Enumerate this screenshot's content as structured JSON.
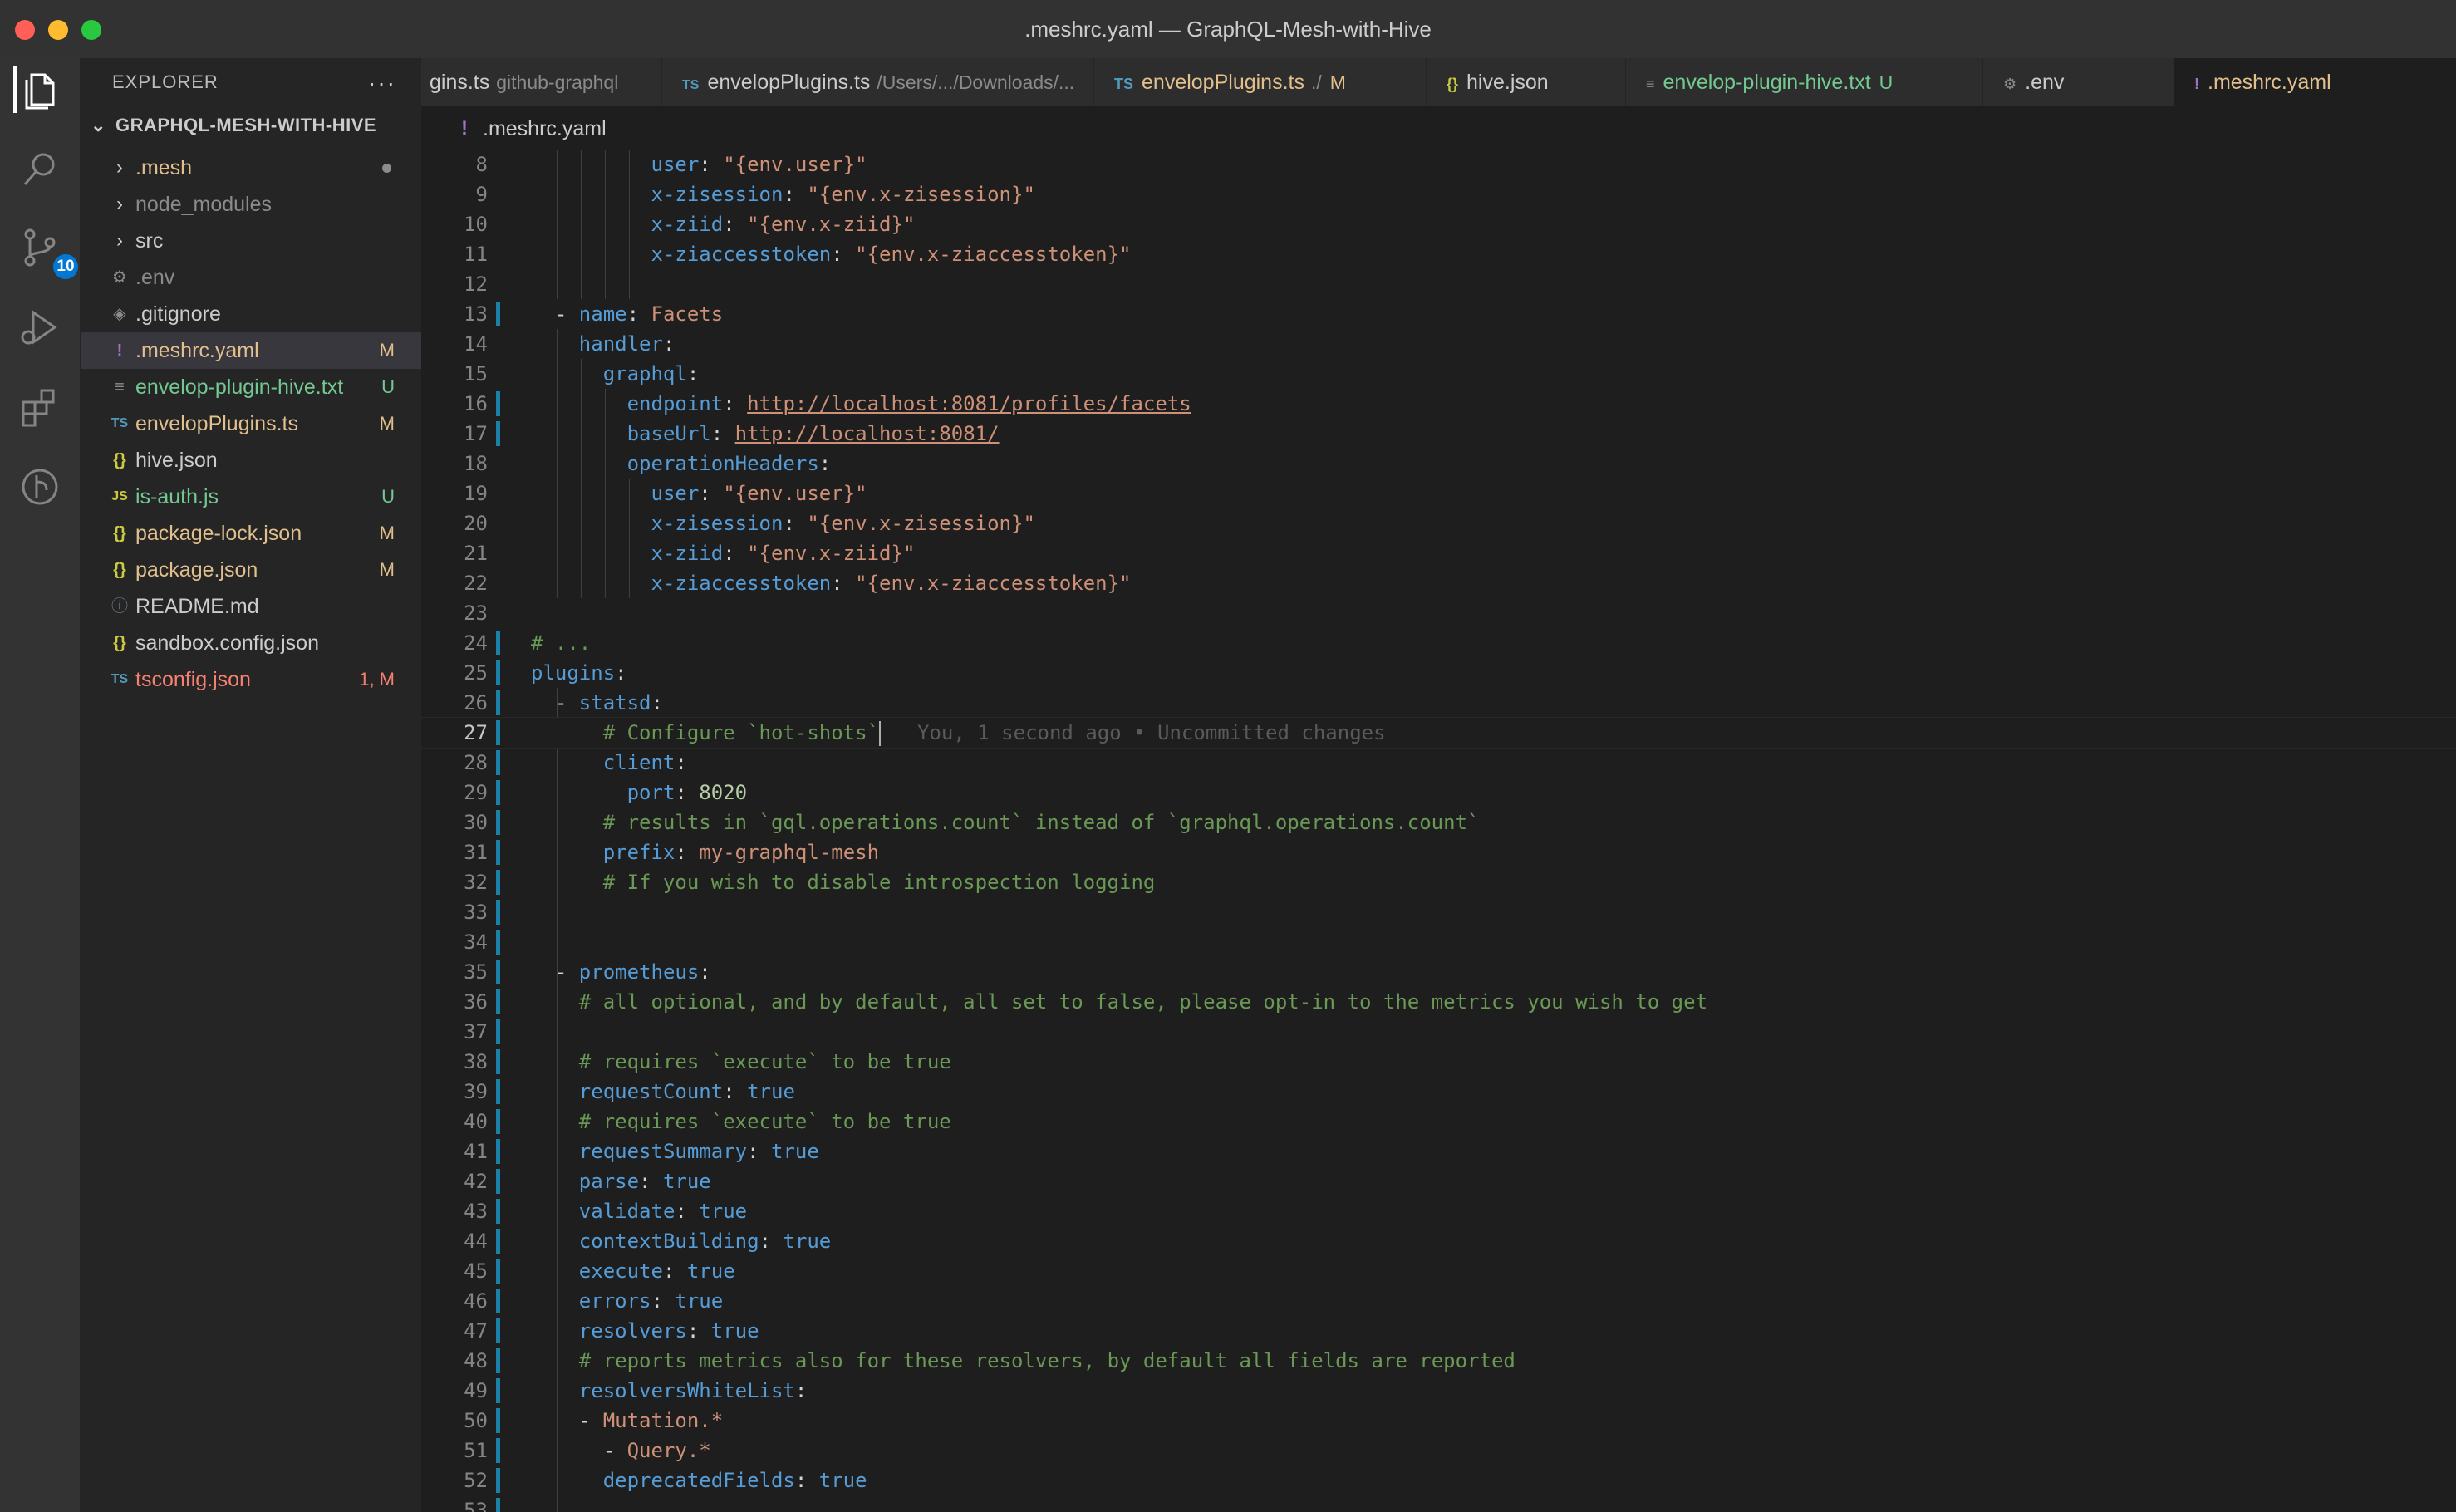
{
  "window": {
    "title": ".meshrc.yaml — GraphQL-Mesh-with-Hive"
  },
  "activity": {
    "scm_badge": "10"
  },
  "sidebar": {
    "header": "EXPLORER",
    "more": "···",
    "project": "GRAPHQL-MESH-WITH-HIVE",
    "items": [
      {
        "name": ".mesh",
        "icon": "›",
        "status": ""
      },
      {
        "name": "node_modules",
        "icon": "›",
        "status": ""
      },
      {
        "name": "src",
        "icon": "›",
        "status": ""
      },
      {
        "name": ".env",
        "icon": "⚙",
        "status": ""
      },
      {
        "name": ".gitignore",
        "icon": "◈",
        "status": ""
      },
      {
        "name": ".meshrc.yaml",
        "icon": "!",
        "status": "M"
      },
      {
        "name": "envelop-plugin-hive.txt",
        "icon": "≡",
        "status": "U"
      },
      {
        "name": "envelopPlugins.ts",
        "icon": "TS",
        "status": "M"
      },
      {
        "name": "hive.json",
        "icon": "{}",
        "status": ""
      },
      {
        "name": "is-auth.js",
        "icon": "JS",
        "status": "U"
      },
      {
        "name": "package-lock.json",
        "icon": "{}",
        "status": "M"
      },
      {
        "name": "package.json",
        "icon": "{}",
        "status": "M"
      },
      {
        "name": "README.md",
        "icon": "ⓘ",
        "status": ""
      },
      {
        "name": "sandbox.config.json",
        "icon": "{}",
        "status": ""
      },
      {
        "name": "tsconfig.json",
        "icon": "TS",
        "status": "1, M"
      }
    ]
  },
  "tabs": [
    {
      "label": "gins.ts",
      "desc": "github-graphql",
      "icon": "",
      "mark": ""
    },
    {
      "label": "envelopPlugins.ts",
      "desc": "/Users/.../Downloads/...",
      "icon": "TS",
      "mark": ""
    },
    {
      "label": "envelopPlugins.ts",
      "desc": "./",
      "icon": "TS",
      "mark": "M"
    },
    {
      "label": "hive.json",
      "desc": "",
      "icon": "{}",
      "mark": ""
    },
    {
      "label": "envelop-plugin-hive.txt",
      "desc": "",
      "icon": "≡",
      "mark": "U"
    },
    {
      "label": ".env",
      "desc": "",
      "icon": "⚙",
      "mark": ""
    },
    {
      "label": ".meshrc.yaml",
      "desc": "",
      "icon": "!",
      "mark": ""
    }
  ],
  "breadcrumb": {
    "icon": "!",
    "file": ".meshrc.yaml"
  },
  "editor": {
    "blame": "You, 1 second ago • Uncommitted changes",
    "lines": [
      {
        "n": "8",
        "parts": [
          [
            "k",
            "user"
          ],
          [
            "p",
            ": "
          ],
          [
            "s",
            "\"{env.user}\""
          ]
        ]
      },
      {
        "n": "9",
        "parts": [
          [
            "k",
            "x-zisession"
          ],
          [
            "p",
            ": "
          ],
          [
            "s",
            "\"{env.x-zisession}\""
          ]
        ]
      },
      {
        "n": "10",
        "parts": [
          [
            "k",
            "x-ziid"
          ],
          [
            "p",
            ": "
          ],
          [
            "s",
            "\"{env.x-ziid}\""
          ]
        ]
      },
      {
        "n": "11",
        "parts": [
          [
            "k",
            "x-ziaccesstoken"
          ],
          [
            "p",
            ": "
          ],
          [
            "s",
            "\"{env.x-ziaccesstoken}\""
          ]
        ]
      },
      {
        "n": "12",
        "parts": []
      },
      {
        "n": "13",
        "parts": [
          [
            "p",
            "- "
          ],
          [
            "k",
            "name"
          ],
          [
            "p",
            ": "
          ],
          [
            "s",
            "Facets"
          ]
        ]
      },
      {
        "n": "14",
        "parts": [
          [
            "k",
            "handler"
          ],
          [
            "p",
            ":"
          ]
        ]
      },
      {
        "n": "15",
        "parts": [
          [
            "k",
            "graphql"
          ],
          [
            "p",
            ":"
          ]
        ]
      },
      {
        "n": "16",
        "parts": [
          [
            "k",
            "endpoint"
          ],
          [
            "p",
            ": "
          ],
          [
            "u",
            "http://localhost:8081/profiles/facets"
          ]
        ]
      },
      {
        "n": "17",
        "parts": [
          [
            "k",
            "baseUrl"
          ],
          [
            "p",
            ": "
          ],
          [
            "u",
            "http://localhost:8081/"
          ]
        ]
      },
      {
        "n": "18",
        "parts": [
          [
            "k",
            "operationHeaders"
          ],
          [
            "p",
            ":"
          ]
        ]
      },
      {
        "n": "19",
        "parts": [
          [
            "k",
            "user"
          ],
          [
            "p",
            ": "
          ],
          [
            "s",
            "\"{env.user}\""
          ]
        ]
      },
      {
        "n": "20",
        "parts": [
          [
            "k",
            "x-zisession"
          ],
          [
            "p",
            ": "
          ],
          [
            "s",
            "\"{env.x-zisession}\""
          ]
        ]
      },
      {
        "n": "21",
        "parts": [
          [
            "k",
            "x-ziid"
          ],
          [
            "p",
            ": "
          ],
          [
            "s",
            "\"{env.x-ziid}\""
          ]
        ]
      },
      {
        "n": "22",
        "parts": [
          [
            "k",
            "x-ziaccesstoken"
          ],
          [
            "p",
            ": "
          ],
          [
            "s",
            "\"{env.x-ziaccesstoken}\""
          ]
        ]
      },
      {
        "n": "23",
        "parts": []
      },
      {
        "n": "24",
        "parts": [
          [
            "c",
            "# ..."
          ]
        ]
      },
      {
        "n": "25",
        "parts": [
          [
            "k",
            "plugins"
          ],
          [
            "p",
            ":"
          ]
        ]
      },
      {
        "n": "26",
        "parts": [
          [
            "p",
            "- "
          ],
          [
            "k",
            "statsd"
          ],
          [
            "p",
            ":"
          ]
        ]
      },
      {
        "n": "27",
        "parts": [
          [
            "c",
            "# Configure `hot-shots`"
          ]
        ]
      },
      {
        "n": "28",
        "parts": [
          [
            "k",
            "client"
          ],
          [
            "p",
            ":"
          ]
        ]
      },
      {
        "n": "29",
        "parts": [
          [
            "k",
            "port"
          ],
          [
            "p",
            ": "
          ],
          [
            "n",
            "8020"
          ]
        ]
      },
      {
        "n": "30",
        "parts": [
          [
            "c",
            "# results in `gql.operations.count` instead of `graphql.operations.count`"
          ]
        ]
      },
      {
        "n": "31",
        "parts": [
          [
            "k",
            "prefix"
          ],
          [
            "p",
            ": "
          ],
          [
            "s",
            "my-graphql-mesh"
          ]
        ]
      },
      {
        "n": "32",
        "parts": [
          [
            "c",
            "# If you wish to disable introspection logging"
          ]
        ]
      },
      {
        "n": "33",
        "parts": []
      },
      {
        "n": "34",
        "parts": []
      },
      {
        "n": "35",
        "parts": [
          [
            "p",
            "- "
          ],
          [
            "k",
            "prometheus"
          ],
          [
            "p",
            ":"
          ]
        ]
      },
      {
        "n": "36",
        "parts": [
          [
            "c",
            "# all optional, and by default, all set to false, please opt-in to the metrics you wish to get"
          ]
        ]
      },
      {
        "n": "37",
        "parts": []
      },
      {
        "n": "38",
        "parts": [
          [
            "c",
            "# requires `execute` to be true"
          ]
        ]
      },
      {
        "n": "39",
        "parts": [
          [
            "k",
            "requestCount"
          ],
          [
            "p",
            ": "
          ],
          [
            "k",
            "true"
          ]
        ]
      },
      {
        "n": "40",
        "parts": [
          [
            "c",
            "# requires `execute` to be true"
          ]
        ]
      },
      {
        "n": "41",
        "parts": [
          [
            "k",
            "requestSummary"
          ],
          [
            "p",
            ": "
          ],
          [
            "k",
            "true"
          ]
        ]
      },
      {
        "n": "42",
        "parts": [
          [
            "k",
            "parse"
          ],
          [
            "p",
            ": "
          ],
          [
            "k",
            "true"
          ]
        ]
      },
      {
        "n": "43",
        "parts": [
          [
            "k",
            "validate"
          ],
          [
            "p",
            ": "
          ],
          [
            "k",
            "true"
          ]
        ]
      },
      {
        "n": "44",
        "parts": [
          [
            "k",
            "contextBuilding"
          ],
          [
            "p",
            ": "
          ],
          [
            "k",
            "true"
          ]
        ]
      },
      {
        "n": "45",
        "parts": [
          [
            "k",
            "execute"
          ],
          [
            "p",
            ": "
          ],
          [
            "k",
            "true"
          ]
        ]
      },
      {
        "n": "46",
        "parts": [
          [
            "k",
            "errors"
          ],
          [
            "p",
            ": "
          ],
          [
            "k",
            "true"
          ]
        ]
      },
      {
        "n": "47",
        "parts": [
          [
            "k",
            "resolvers"
          ],
          [
            "p",
            ": "
          ],
          [
            "k",
            "true"
          ]
        ]
      },
      {
        "n": "48",
        "parts": [
          [
            "c",
            "# reports metrics also for these resolvers, by default all fields are reported"
          ]
        ]
      },
      {
        "n": "49",
        "parts": [
          [
            "k",
            "resolversWhiteList"
          ],
          [
            "p",
            ":"
          ]
        ]
      },
      {
        "n": "50",
        "parts": [
          [
            "p",
            "- "
          ],
          [
            "s",
            "Mutation.*"
          ]
        ]
      },
      {
        "n": "51",
        "parts": [
          [
            "p",
            "- "
          ],
          [
            "s",
            "Query.*"
          ]
        ]
      },
      {
        "n": "52",
        "parts": [
          [
            "k",
            "deprecatedFields"
          ],
          [
            "p",
            ": "
          ],
          [
            "k",
            "true"
          ]
        ]
      },
      {
        "n": "53",
        "parts": []
      }
    ]
  }
}
